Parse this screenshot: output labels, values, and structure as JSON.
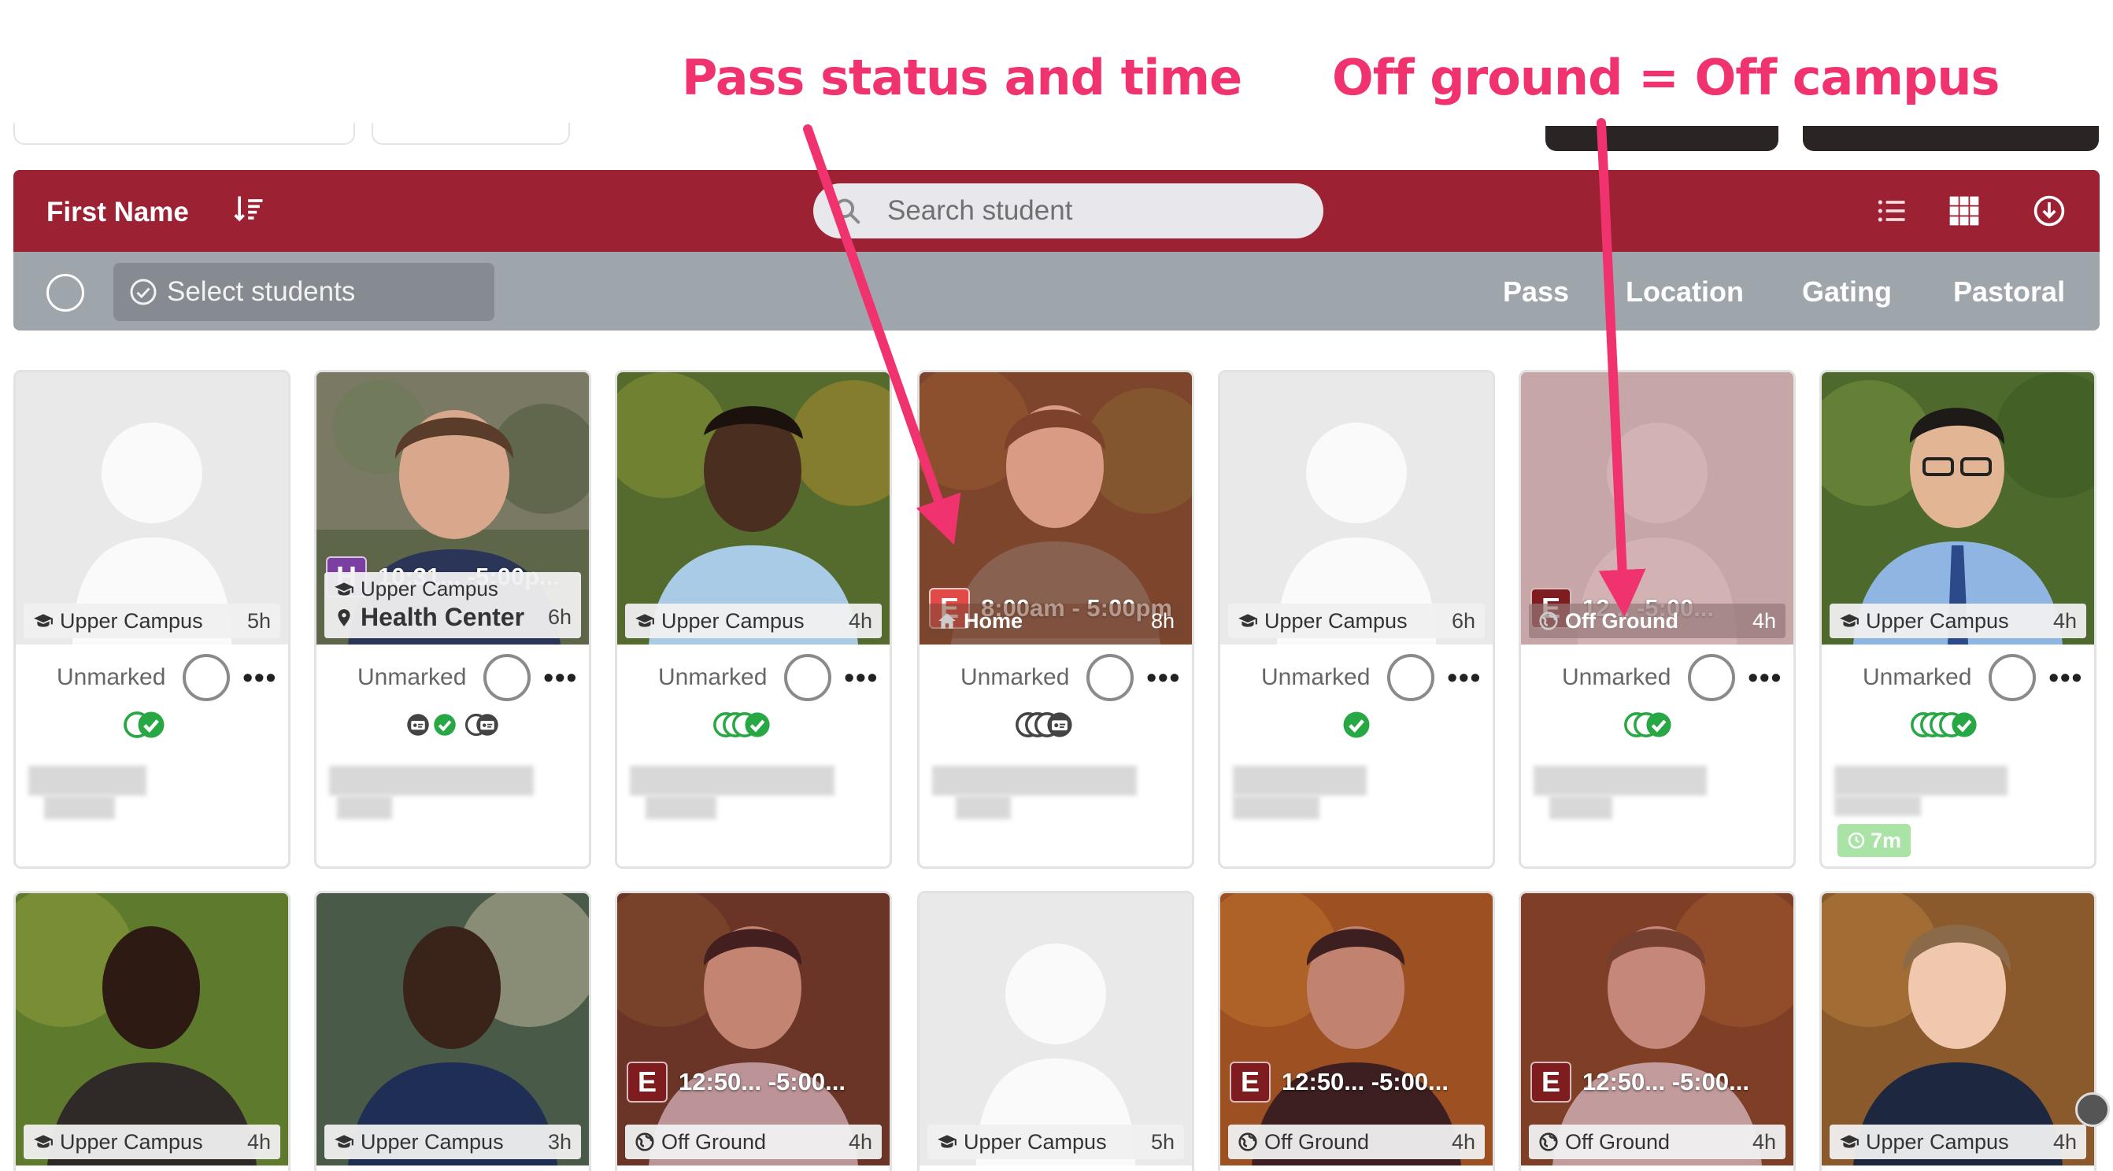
{
  "annotations": {
    "pass_status": "Pass status and time",
    "off_ground": "Off ground = Off campus"
  },
  "header": {
    "sort_label": "First Name",
    "search_placeholder": "Search student"
  },
  "subbar": {
    "select_students": "Select students",
    "actions": [
      "Pass",
      "Location",
      "Gating",
      "Pastoral"
    ]
  },
  "colors": {
    "header_bg": "#9b2133",
    "subbar_bg": "#9ea5ab",
    "annotation": "#f0326e",
    "pass_h": "#7a3fa0",
    "pass_e_active": "#e24a47",
    "pass_e": "#7e1c20",
    "status_green": "#28a745"
  },
  "mark_label": "Unmarked",
  "more_label": "•••",
  "cards_row1": [
    {
      "photo": "placeholder",
      "location": "Upper Campus",
      "location_icon": "graduation-cap-icon",
      "duration": "5h",
      "status_icons": [
        "check-green"
      ]
    },
    {
      "photo": "photo",
      "pass": {
        "badge": "H",
        "time": "10:31... -5:00p..."
      },
      "location_line1": "Upper Campus",
      "location": "Health Center",
      "location_icon": "map-pin-icon",
      "duration": "6h",
      "status_icons": [
        "id-card",
        "check-green",
        "id-card-group"
      ]
    },
    {
      "photo": "photo",
      "location": "Upper Campus",
      "location_icon": "graduation-cap-icon",
      "duration": "4h",
      "status_icons": [
        "check-green-stack"
      ]
    },
    {
      "photo": "photo",
      "pass": {
        "badge": "E",
        "time": "8:00am - 5:00pm"
      },
      "location": "Home",
      "location_icon": "home-icon",
      "duration": "8h",
      "status_icons": [
        "id-card-stack"
      ]
    },
    {
      "photo": "placeholder",
      "location": "Upper Campus",
      "location_icon": "graduation-cap-icon",
      "duration": "6h",
      "status_icons": [
        "check-green"
      ]
    },
    {
      "photo": "placeholder-tint",
      "pass": {
        "badge": "E",
        "time": "12... -5:00..."
      },
      "location": "Off Ground",
      "location_icon": "globe-icon",
      "duration": "4h",
      "status_icons": [
        "check-green-stack"
      ]
    },
    {
      "photo": "photo",
      "location": "Upper Campus",
      "location_icon": "graduation-cap-icon",
      "duration": "4h",
      "status_icons": [
        "check-green-stack-long"
      ],
      "timer": "7m"
    }
  ],
  "cards_row2": [
    {
      "location": "Upper Campus",
      "duration": "4h"
    },
    {
      "location": "Upper Campus",
      "duration": "3h"
    },
    {
      "pass": {
        "badge": "E",
        "time": "12:50... -5:00..."
      },
      "location": "Off Ground",
      "duration": "4h"
    },
    {
      "location": "Upper Campus",
      "duration": "5h"
    },
    {
      "pass": {
        "badge": "E",
        "time": "12:50... -5:00..."
      },
      "location": "Off Ground",
      "duration": "4h"
    },
    {
      "pass": {
        "badge": "E",
        "time": "12:50... -5:00..."
      },
      "location": "Off Ground",
      "duration": "4h"
    },
    {
      "location": "Upper Campus",
      "duration": "4h"
    }
  ]
}
